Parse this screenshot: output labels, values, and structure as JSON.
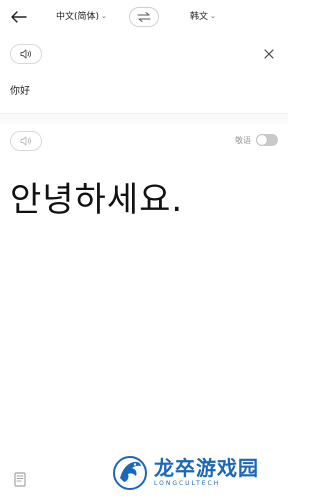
{
  "header": {
    "source_language": "中文(简体)",
    "target_language": "韩文",
    "back_icon": "arrow-left-icon",
    "swap_icon": "swap-arrows-icon",
    "chevron_icon": "chevron-down-icon"
  },
  "input": {
    "text": "你好",
    "speaker_icon": "speaker-icon",
    "clear_icon": "close-icon"
  },
  "result": {
    "text": "안녕하세요.",
    "speaker_icon": "speaker-icon",
    "honorific_label": "敬语",
    "honorific_on": false,
    "book_icon": "book-icon"
  },
  "watermark": {
    "main_text": "龙卒游戏园",
    "sub_text": "LONGCULTECH"
  },
  "colors": {
    "accent": "#1a66b8",
    "toggle_off": "#c9c9c9"
  }
}
